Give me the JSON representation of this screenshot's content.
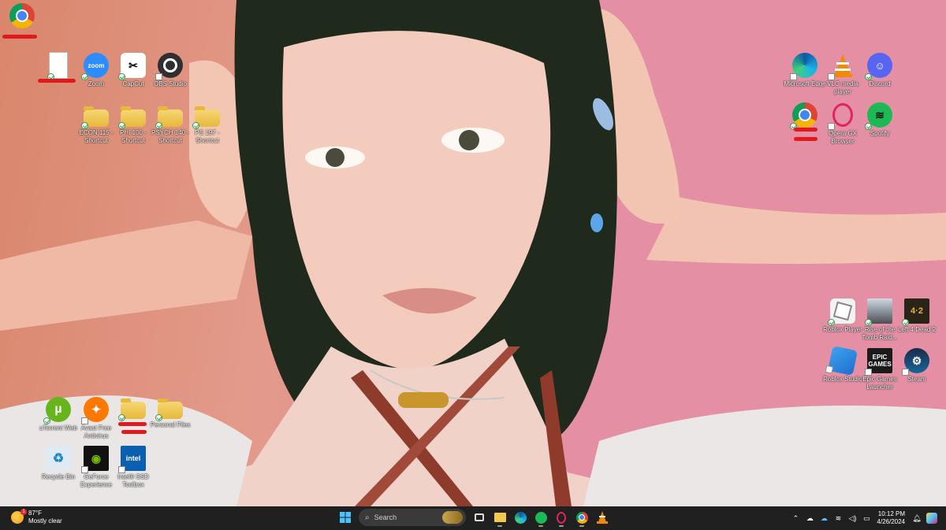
{
  "desktop": {
    "icons": [
      {
        "id": "chrome-tl",
        "label": "",
        "icon": "chrome-icon"
      },
      {
        "id": "doc-file",
        "label": "",
        "icon": "document-icon"
      },
      {
        "id": "zoom",
        "label": "Zoom",
        "icon": "zoom-icon",
        "color": "#2d8cff"
      },
      {
        "id": "capcut",
        "label": "CapCut",
        "icon": "capcut-icon"
      },
      {
        "id": "obs",
        "label": "OBS Studio",
        "icon": "obs-icon"
      },
      {
        "id": "econ",
        "label": "ECON 115 - Shortcut",
        "icon": "folder-icon"
      },
      {
        "id": "phil",
        "label": "PHI 100 - Shortcut",
        "icon": "folder-icon"
      },
      {
        "id": "psych",
        "label": "PSYCH 140 - Shortcut",
        "icon": "folder-icon"
      },
      {
        "id": "ps197",
        "label": "PS 197 - Shortcut",
        "icon": "folder-icon"
      },
      {
        "id": "edge",
        "label": "Microsoft Edge",
        "icon": "edge-icon"
      },
      {
        "id": "vlc",
        "label": "VLC media player",
        "icon": "vlc-icon"
      },
      {
        "id": "discord",
        "label": "Discord",
        "icon": "discord-icon",
        "color": "#5865f2"
      },
      {
        "id": "chrome-r",
        "label": "",
        "icon": "chrome-icon"
      },
      {
        "id": "opera",
        "label": "Opera GX Browser",
        "icon": "opera-gx-icon"
      },
      {
        "id": "spotify",
        "label": "Spotify",
        "icon": "spotify-icon",
        "color": "#1db954"
      },
      {
        "id": "roblox-player",
        "label": "Roblox Player",
        "icon": "roblox-icon"
      },
      {
        "id": "tomb-raider",
        "label": "Rise of the Tomb Raid...",
        "icon": "tomb-raider-icon"
      },
      {
        "id": "l4d2",
        "label": "Left 4 Dead 2",
        "icon": "left4dead-icon"
      },
      {
        "id": "roblox-studio",
        "label": "Roblox Studio",
        "icon": "roblox-studio-icon"
      },
      {
        "id": "epic",
        "label": "Epic Games Launcher",
        "icon": "epic-games-icon"
      },
      {
        "id": "steam",
        "label": "Steam",
        "icon": "steam-icon"
      },
      {
        "id": "utorrent",
        "label": "uTorrent Web",
        "icon": "utorrent-icon"
      },
      {
        "id": "avast",
        "label": "Avast Free Antivirus",
        "icon": "avast-icon"
      },
      {
        "id": "folder-red",
        "label": "",
        "icon": "folder-icon"
      },
      {
        "id": "personal",
        "label": "Personal Files",
        "icon": "folder-icon"
      },
      {
        "id": "recycle",
        "label": "Recycle Bin",
        "icon": "recycle-bin-icon"
      },
      {
        "id": "geforce",
        "label": "GeForce Experience",
        "icon": "nvidia-icon"
      },
      {
        "id": "intel",
        "label": "Intel® SSD Toolbox",
        "icon": "intel-icon"
      }
    ]
  },
  "taskbar": {
    "weather": {
      "temp": "87°F",
      "condition": "Mostly clear",
      "badge": "1"
    },
    "search_placeholder": "Search",
    "apps": [
      "windows-start-icon",
      "task-view-icon",
      "file-explorer-icon",
      "edge-icon",
      "spotify-icon",
      "opera-gx-icon",
      "chrome-icon",
      "vlc-icon"
    ],
    "tray": {
      "time": "10:12 PM",
      "date": "4/26/2024"
    }
  }
}
